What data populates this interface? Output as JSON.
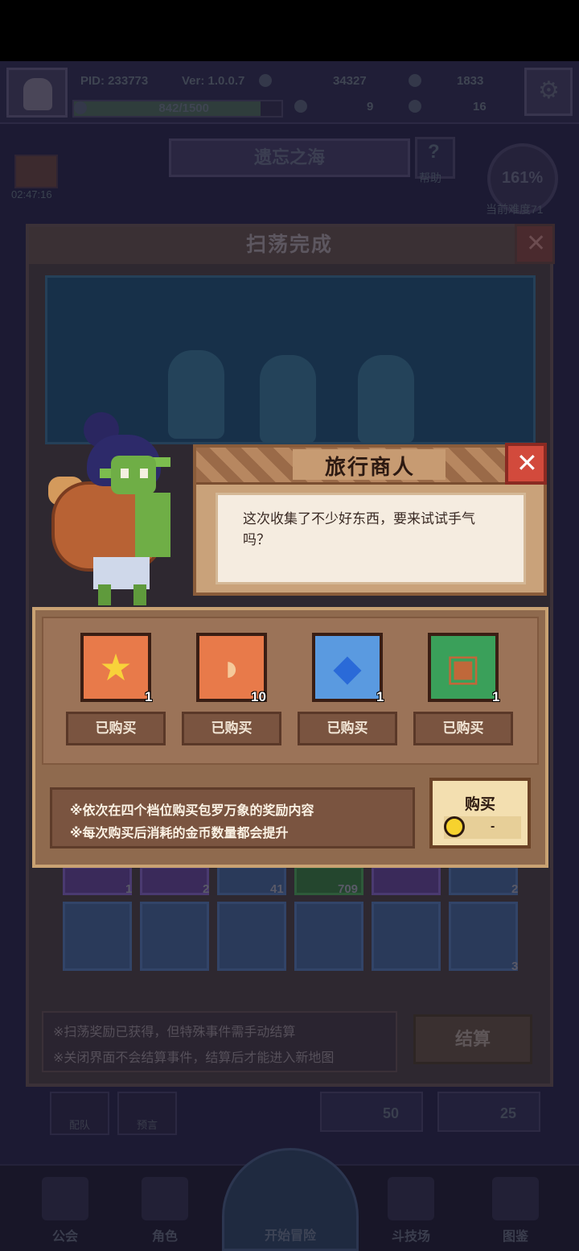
{
  "hud": {
    "pid": "PID: 233773",
    "version": "Ver: 1.0.0.7",
    "gold": "34327",
    "gems": "1833",
    "xp": "842/1500",
    "clover": "9",
    "keys": "16",
    "timer": "02:47:16"
  },
  "map": {
    "name": "遗忘之海",
    "help": "帮助",
    "difficulty_pct": "161%",
    "difficulty_label": "当前难度71"
  },
  "sweep": {
    "title": "扫荡完成",
    "grid_counts": [
      "1",
      "2",
      "41",
      "709",
      "2",
      "3"
    ],
    "notes": [
      "※扫荡奖励已获得，但特殊事件需手动结算",
      "※关闭界面不会结算事件，结算后才能进入新地图"
    ],
    "settle_label": "结算"
  },
  "subtabs": {
    "team": "配队",
    "preset": "预言",
    "cost1": "50",
    "cost2": "25"
  },
  "nav": {
    "guild": "公会",
    "role": "角色",
    "start": "开始冒险",
    "arena": "斗技场",
    "codex": "图鉴"
  },
  "merchant": {
    "title": "旅行商人",
    "message": "这次收集了不少好东西，要来试试手气吗？"
  },
  "shop": {
    "items": [
      {
        "icon": "star-icon",
        "glyph": "★",
        "count": "1",
        "status": "已购买",
        "color": "#e87a4a"
      },
      {
        "icon": "fish-icon",
        "glyph": "🐟",
        "count": "10",
        "status": "已购买",
        "color": "#e87a4a"
      },
      {
        "icon": "crystal-icon",
        "glyph": "◆",
        "count": "1",
        "status": "已购买",
        "color": "#5a9ae0"
      },
      {
        "icon": "basket-icon",
        "glyph": "▣",
        "count": "1",
        "status": "已购买",
        "color": "#3aa05a"
      }
    ],
    "rules": [
      "※依次在四个档位购买包罗万象的奖励内容",
      "※每次购买后消耗的金币数量都会提升"
    ],
    "buy_label": "购买",
    "price": "-"
  }
}
